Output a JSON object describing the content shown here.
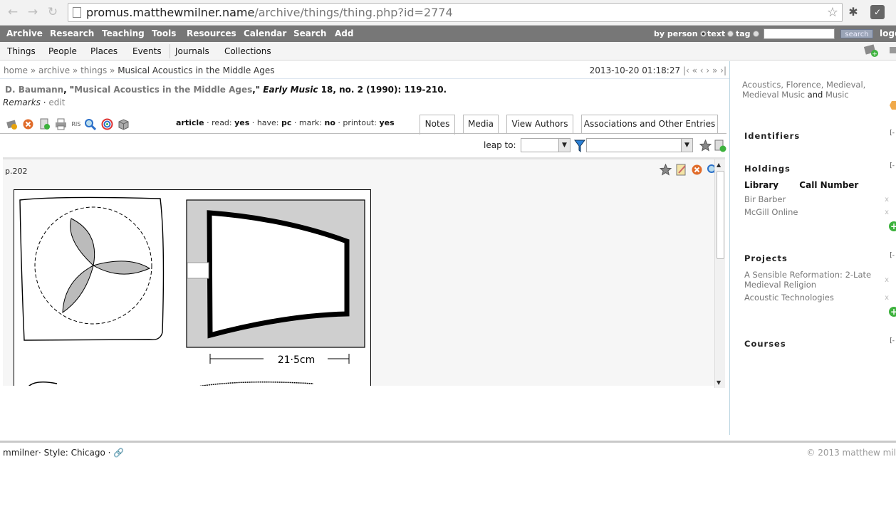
{
  "browser": {
    "url_host": "promus.matthewmilner.name",
    "url_path": "/archive/things/thing.php?id=2774"
  },
  "topmenu": {
    "items": [
      "Archive",
      "Research",
      "Teaching",
      "Tools",
      "Resources",
      "Calendar",
      "Search",
      "Add"
    ],
    "search_opts": [
      "by person",
      "text",
      "tag"
    ],
    "search_button": "search",
    "logout": "logo"
  },
  "submenu": {
    "items": [
      "Things",
      "People",
      "Places",
      "Events",
      "Journals",
      "Collections"
    ]
  },
  "breadcrumb": {
    "home": "home",
    "archive": "archive",
    "things": "things",
    "sep": "»",
    "current": "Musical Acoustics in the Middle Ages"
  },
  "timestamp": "2013-10-20 01:18:27",
  "pager": "|‹ « ‹ › » ›|",
  "citation": {
    "author": "D. Baumann",
    "title": "Musical Acoustics in the Middle Ages",
    "journal": "Early Music",
    "details": " 18, no. 2 (1990): 119-210."
  },
  "remarks": {
    "label": "Remarks",
    "edit": "edit"
  },
  "ris_label": "RIS",
  "status": {
    "type": "article",
    "read_label": "read:",
    "read": "yes",
    "have_label": "have:",
    "have": "pc",
    "mark_label": "mark:",
    "mark": "no",
    "printout_label": "printout:",
    "printout": "yes"
  },
  "tabs": [
    "Notes",
    "Media",
    "View Authors",
    "Associations and Other Entries"
  ],
  "leap_label": "leap to:",
  "note": {
    "page": "p.202",
    "figure_caption": "21·5cm"
  },
  "sidebar": {
    "tags": [
      "Acoustics",
      "Florence",
      "Medieval",
      "Medieval Music",
      "Music"
    ],
    "tags_and": "and",
    "identifiers": "Identifiers",
    "holdings": "Holdings",
    "library_col": "Library",
    "call_col": "Call Number",
    "holdings_items": [
      "Bir Barber",
      "McGill Online"
    ],
    "projects": "Projects",
    "projects_items": [
      "A Sensible Reformation: 2-Late Medieval Religion",
      "Acoustic Technologies"
    ],
    "courses": "Courses",
    "collapse_glyph": "[-",
    "remove_glyph": "x"
  },
  "footer": {
    "user": "mmilner",
    "style_label": "· Style:",
    "style": "Chicago",
    "dot": "·",
    "copyright": "© 2013 matthew mil"
  }
}
